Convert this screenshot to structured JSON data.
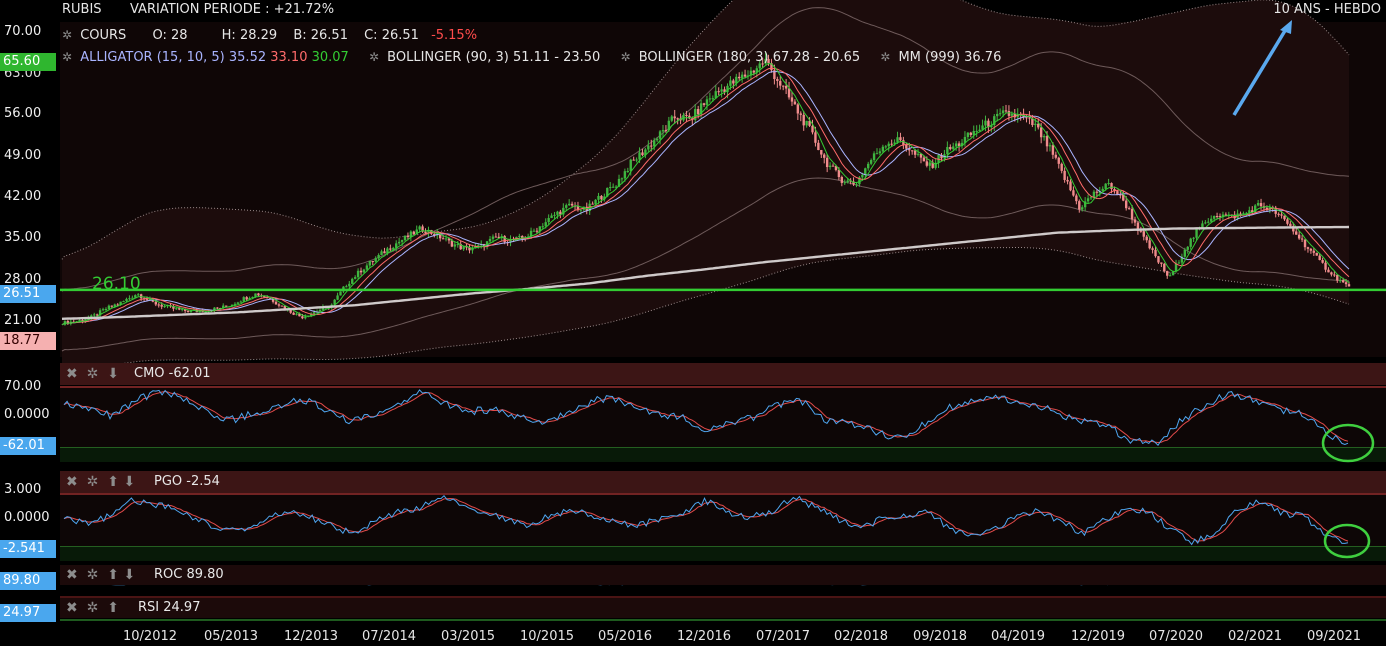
{
  "header": {
    "symbol": "RUBIS",
    "variation": "VARIATION PERIODE : +21.72%",
    "period": "10 ANS - HEBDO"
  },
  "ohlc": {
    "label": "COURS",
    "open": "O: 28",
    "high": "H: 28.29",
    "low": "B: 26.51",
    "close": "C: 26.51",
    "change": "-5.15%"
  },
  "indicators": {
    "alligator_label": "ALLIGATOR (15, 10, 5)",
    "alligator_v1": "35.52",
    "alligator_v2": "33.10",
    "alligator_v3": "30.07",
    "bollinger1": "BOLLINGER (90, 3) 51.11 - 23.50",
    "bollinger2": "BOLLINGER (180, 3) 67.28 - 20.65",
    "mm": "MM (999) 36.76"
  },
  "main_axis": {
    "ticks": [
      "70.00",
      "63.00",
      "56.00",
      "49.00",
      "42.00",
      "35.00",
      "28.00",
      "21.00"
    ],
    "badge_high": "65.60",
    "badge_last": "26.51",
    "badge_low": "18.77",
    "support_label": "26.10",
    "support_value": 26.1
  },
  "panels": {
    "cmo": {
      "label": "CMO -62.01",
      "ticks": [
        "70.00",
        "0.0000"
      ],
      "badge": "-62.01"
    },
    "pgo": {
      "label": "PGO -2.54",
      "ticks": [
        "3.000",
        "0.0000"
      ],
      "badge": "-2.541"
    },
    "roc": {
      "label": "ROC 89.80",
      "badge": "89.80"
    },
    "rsi": {
      "label": "RSI 24.97",
      "badge": "24.97"
    }
  },
  "x_axis": {
    "labels": [
      "10/2012",
      "05/2013",
      "12/2013",
      "07/2014",
      "03/2015",
      "10/2015",
      "05/2016",
      "12/2016",
      "07/2017",
      "02/2018",
      "09/2018",
      "04/2019",
      "12/2019",
      "07/2020",
      "02/2021",
      "09/2021"
    ]
  },
  "colors": {
    "up": "#3fb540",
    "down": "#f08c8c",
    "support_line": "#33cc33",
    "alligator_label": "#a9b4ff",
    "alligator_v1": "#a9b4ff",
    "alligator_v2": "#ff6b6b",
    "alligator_v3": "#33cc33",
    "change_negative": "#ff4c4c",
    "annotation": "#5aa9ef",
    "badge_high": "#2fb62f",
    "badge_last": "#4aa7ee",
    "badge_low": "#f5b0b0",
    "circle": "#3fcf3f"
  },
  "chart_data": [
    {
      "type": "line",
      "title": "RUBIS",
      "subtitle": "10 ANS - HEBDO",
      "x_labels": [
        "10/2012",
        "05/2013",
        "12/2013",
        "07/2014",
        "03/2015",
        "10/2015",
        "05/2016",
        "12/2016",
        "07/2017",
        "02/2018",
        "09/2018",
        "04/2019",
        "12/2019",
        "07/2020",
        "02/2021",
        "09/2021"
      ],
      "ylim": [
        17,
        72
      ],
      "series": [
        {
          "name": "COURS",
          "values": [
            20.5,
            20.8,
            21.5,
            23.0,
            24.0,
            25.5,
            24.0,
            23.2,
            22.6,
            22.5,
            22.8,
            23.3,
            24.5,
            25.5,
            24.5,
            22.8,
            21.5,
            22.5,
            23.5,
            27.0,
            29.5,
            31.5,
            33.5,
            35.0,
            36.5,
            35.5,
            34.0,
            33.0,
            33.5,
            35.0,
            34.5,
            35.0,
            37.0,
            39.0,
            40.5,
            39.5,
            42.0,
            44.0,
            47.5,
            50.0,
            52.5,
            55.5,
            55.0,
            58.0,
            60.0,
            61.5,
            63.0,
            65.0,
            61.0,
            57.0,
            53.0,
            48.0,
            45.0,
            44.0,
            48.0,
            51.0,
            51.5,
            49.0,
            47.0,
            49.5,
            51.0,
            53.0,
            54.5,
            56.0,
            55.5,
            54.0,
            50.0,
            45.0,
            40.0,
            42.5,
            44.0,
            41.0,
            36.0,
            32.0,
            28.0,
            33.0,
            36.5,
            39.0,
            38.5,
            39.0,
            40.5,
            39.5,
            37.0,
            34.0,
            31.0,
            28.5,
            26.51
          ]
        },
        {
          "name": "MM (999)",
          "values": [
            21.2,
            21.5,
            21.9,
            22.3,
            22.9,
            23.5,
            24.5,
            25.5,
            26.3,
            27.2,
            28.5,
            29.6,
            30.8,
            31.8,
            32.8,
            33.8,
            34.8,
            35.8,
            36.2,
            36.5,
            36.6,
            36.7,
            36.76
          ]
        }
      ]
    },
    {
      "type": "line",
      "title": "CMO -62.01",
      "ylim": [
        -75,
        75
      ],
      "series": [
        {
          "name": "CMO",
          "values": [
            35,
            20,
            5,
            40,
            65,
            45,
            15,
            -5,
            10,
            25,
            45,
            20,
            -10,
            5,
            25,
            60,
            35,
            15,
            20,
            5,
            -10,
            10,
            35,
            50,
            20,
            10,
            0,
            -30,
            -10,
            0,
            30,
            40,
            -5,
            -10,
            -30,
            -50,
            -20,
            20,
            35,
            50,
            40,
            30,
            5,
            -10,
            -25,
            -55,
            -60,
            -5,
            30,
            60,
            45,
            20,
            10,
            -30,
            -62.01
          ]
        }
      ]
    },
    {
      "type": "line",
      "title": "PGO -2.54",
      "ylim": [
        -3.4,
        3.4
      ],
      "series": [
        {
          "name": "PGO",
          "values": [
            0.2,
            -0.3,
            0.5,
            2.5,
            2.0,
            1.5,
            0.3,
            -1.0,
            -1.2,
            0.0,
            1.2,
            0.6,
            -0.5,
            -1.5,
            -0.2,
            1.0,
            1.5,
            2.8,
            2.0,
            1.0,
            0.2,
            -0.6,
            0.8,
            1.3,
            0.5,
            -0.2,
            -0.5,
            0.4,
            1.0,
            2.5,
            1.0,
            0.5,
            1.2,
            3.0,
            1.5,
            0.2,
            -0.8,
            0.3,
            0.6,
            1.0,
            -0.8,
            -2.0,
            -1.0,
            0.5,
            1.2,
            0.0,
            -1.5,
            0.2,
            1.5,
            1.0,
            -1.0,
            -2.6,
            -1.5,
            1.5,
            2.5,
            1.0,
            0.5,
            -1.8,
            -2.54
          ]
        }
      ]
    }
  ]
}
